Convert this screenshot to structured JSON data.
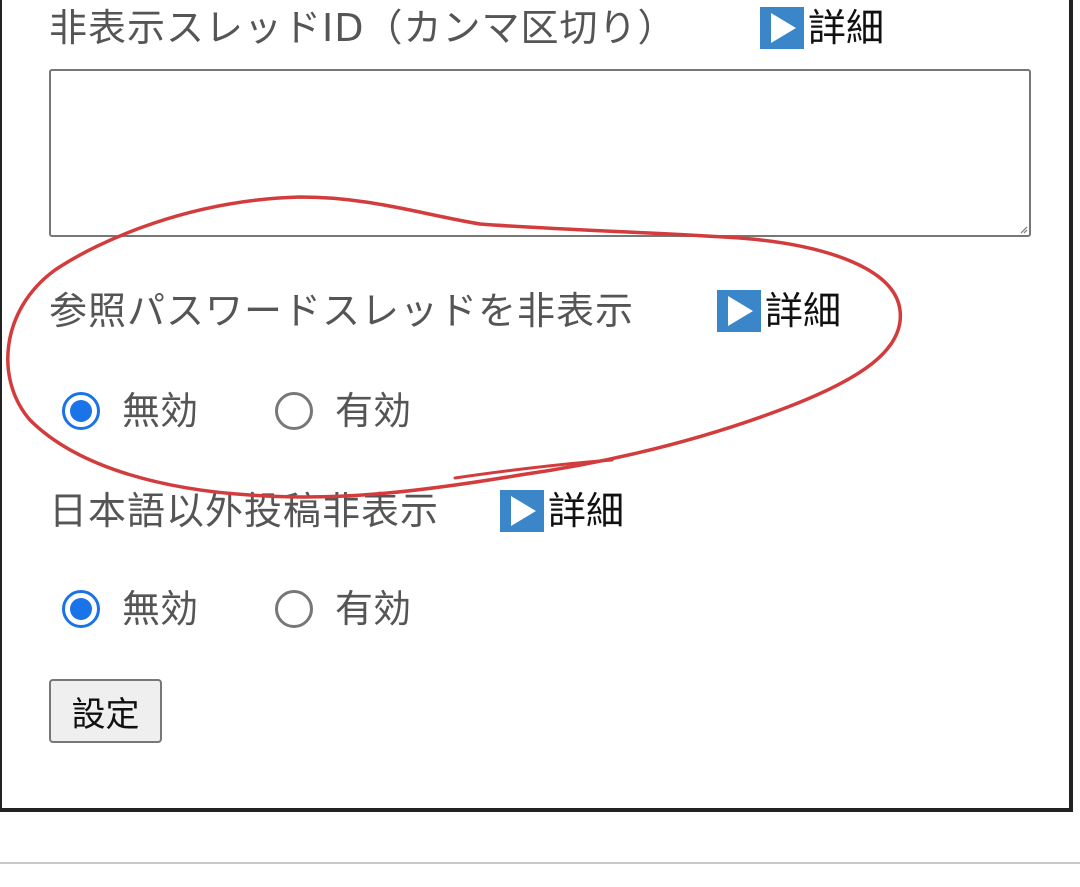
{
  "sections": [
    {
      "label": "非表示スレッドID（カンマ区切り）",
      "details_label": "詳細"
    },
    {
      "label": "参照パスワードスレッドを非表示",
      "details_label": "詳細",
      "options": [
        {
          "label": "無効",
          "checked": true
        },
        {
          "label": "有効",
          "checked": false
        }
      ]
    },
    {
      "label": "日本語以外投稿非表示",
      "details_label": "詳細",
      "options": [
        {
          "label": "無効",
          "checked": true
        },
        {
          "label": "有効",
          "checked": false
        }
      ]
    }
  ],
  "textarea": {
    "value": ""
  },
  "submit_label": "設定",
  "colors": {
    "accent": "#1a73e8",
    "details_icon": "#3a86c8",
    "annotation": "#d23c3c",
    "label_text": "#555555"
  },
  "icons": {
    "details": "play-triangle-icon"
  }
}
